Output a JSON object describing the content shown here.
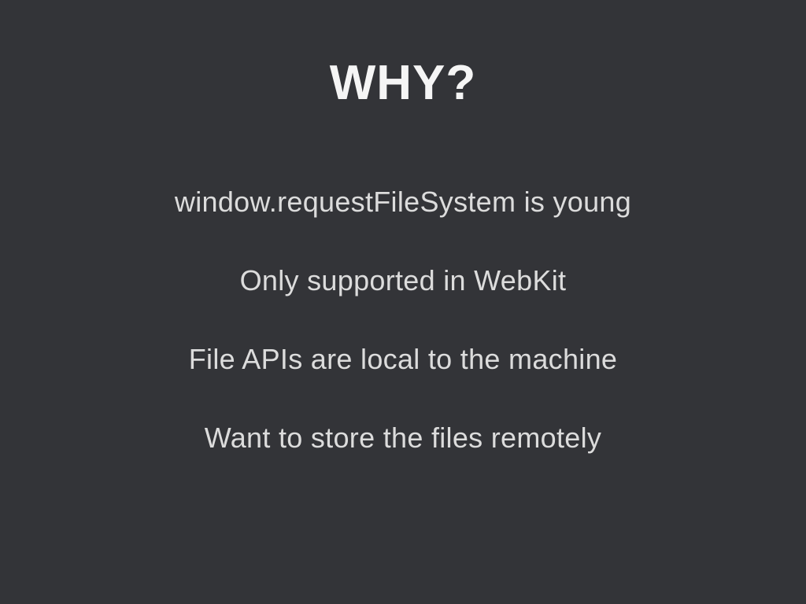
{
  "slide": {
    "title": "WHY?",
    "points": [
      "window.requestFileSystem is young",
      "Only supported in WebKit",
      "File APIs are local to the machine",
      "Want to store the files remotely"
    ]
  }
}
